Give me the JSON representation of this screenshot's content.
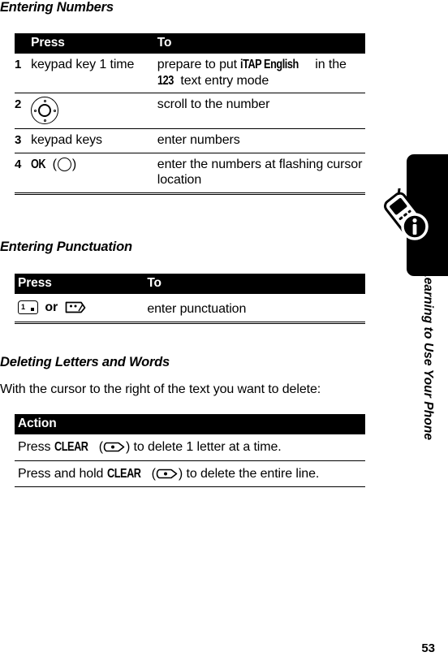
{
  "page": {
    "number": "53",
    "sidebar_label": "Learning to Use Your Phone"
  },
  "sections": [
    {
      "title": "Entering Numbers",
      "table": {
        "headers": [
          "Press",
          "To"
        ],
        "rows": [
          {
            "num": "1",
            "press_text": "keypad key 1 time",
            "to_parts": [
              {
                "text": "prepare to put ",
                "style": "normal"
              },
              {
                "text": "iTAP English",
                "style": "cond"
              },
              {
                "text": " in the ",
                "style": "normal"
              },
              {
                "text": "123",
                "style": "cond"
              },
              {
                "text": " text entry mode",
                "style": "normal"
              }
            ]
          },
          {
            "num": "2",
            "press_icon": "nav-disc-icon",
            "to_text": "scroll to the number"
          },
          {
            "num": "3",
            "press_text": "keypad keys",
            "to_text": "enter numbers"
          },
          {
            "num": "4",
            "press_label": "OK",
            "press_icon": "center-select-key-icon",
            "to_text": "enter the numbers at flashing cursor location"
          }
        ]
      }
    },
    {
      "title": "Entering Punctuation",
      "table": {
        "headers": [
          "Press",
          "To"
        ],
        "rows": [
          {
            "press_icons": [
              "key-1-icon",
              "key-star-icon"
            ],
            "press_conjunction": "or",
            "to_text": "enter punctuation"
          }
        ]
      }
    },
    {
      "title": "Deleting Letters and Words",
      "intro": "With the cursor to the right of the text you want to delete:",
      "table": {
        "headers": [
          "Action"
        ],
        "rows": [
          {
            "parts": [
              {
                "text": "Press ",
                "style": "normal"
              },
              {
                "text": "CLEAR",
                "style": "cond"
              },
              {
                "text": " (",
                "style": "normal"
              },
              {
                "icon": "clear-key-icon"
              },
              {
                "text": ") to delete 1 letter at a time.",
                "style": "normal"
              }
            ]
          },
          {
            "parts": [
              {
                "text": "Press and hold ",
                "style": "normal"
              },
              {
                "text": "CLEAR",
                "style": "cond"
              },
              {
                "text": " (",
                "style": "normal"
              },
              {
                "icon": "clear-key-icon"
              },
              {
                "text": ") to delete the entire line.",
                "style": "normal"
              }
            ]
          }
        ]
      }
    }
  ],
  "colors": {
    "header_bar": "#000000",
    "header_text": "#ffffff",
    "body_text": "#000000",
    "sidebar_tab": "#000000"
  }
}
